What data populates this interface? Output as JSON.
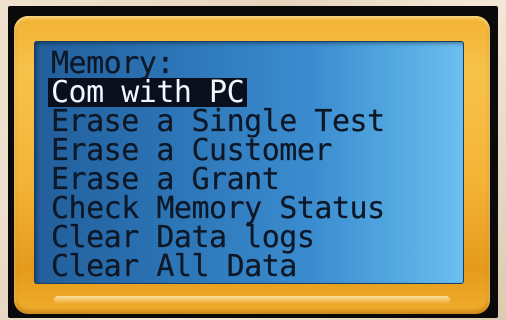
{
  "lcd": {
    "title": "Memory:",
    "items": [
      {
        "label": "Com with PC",
        "selected": true
      },
      {
        "label": "Erase a Single Test",
        "selected": false
      },
      {
        "label": "Erase a Customer",
        "selected": false
      },
      {
        "label": "Erase a Grant",
        "selected": false
      },
      {
        "label": "Check Memory Status",
        "selected": false
      },
      {
        "label": "Clear Data logs",
        "selected": false
      },
      {
        "label": "Clear All Data",
        "selected": false
      }
    ]
  },
  "colors": {
    "bezel": "#f4b437",
    "screen_left": "#225e9a",
    "screen_right": "#6cbfef",
    "text": "#0d1726",
    "selection_bg": "#0a0f1d",
    "selection_text": "#f2f6ff"
  }
}
